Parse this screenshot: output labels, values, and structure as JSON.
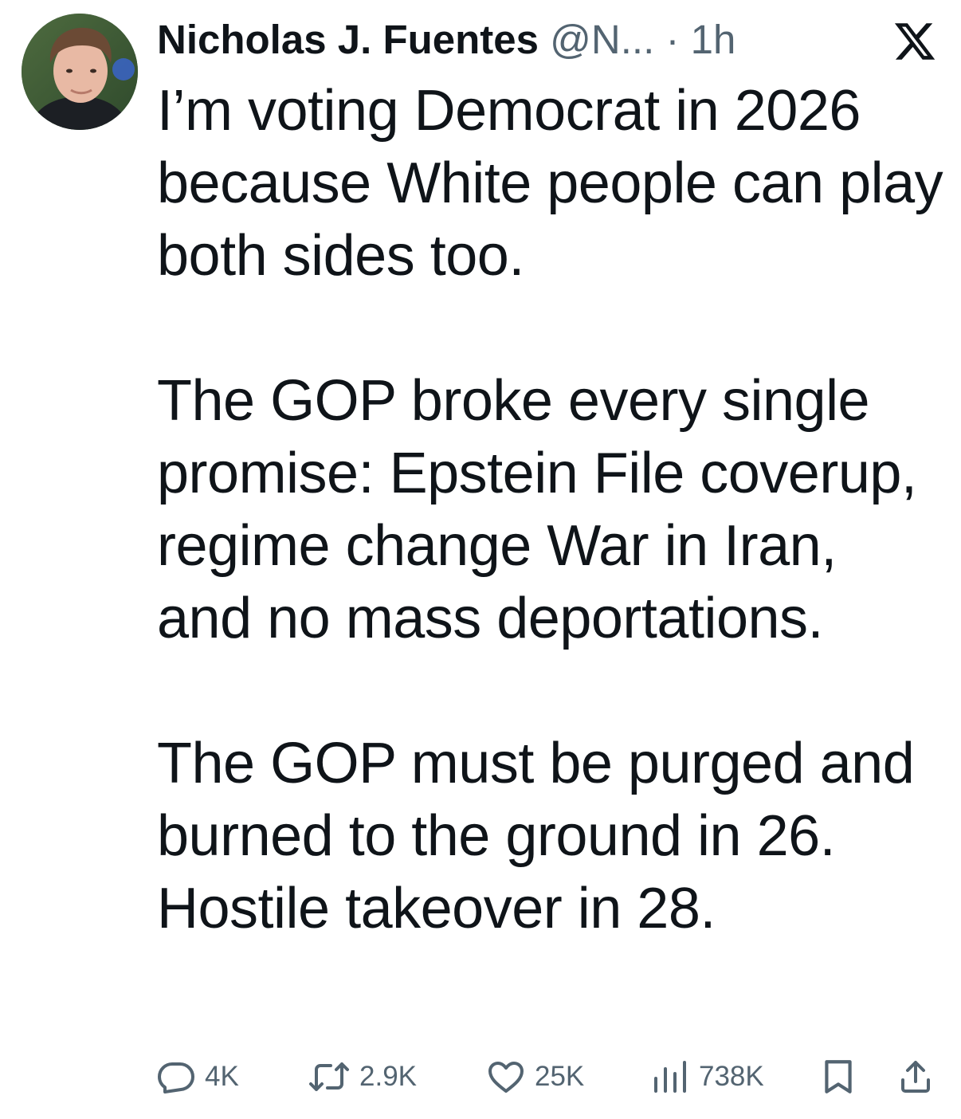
{
  "tweet": {
    "author_name": "Nicholas J. Fuentes",
    "handle": "@N...",
    "separator": "·",
    "time": "1h",
    "paragraphs": [
      "I’m voting Democrat in 2026 because White people can play both sides too.",
      "The GOP broke every single promise: Epstein File coverup, regime change War in Iran, and no mass deportations.",
      "The GOP must be purged and burned to the ground in 26. Hostile takeover in 28."
    ]
  },
  "actions": {
    "replies": "4K",
    "reposts": "2.9K",
    "likes": "25K",
    "views": "738K"
  },
  "icons": {
    "platform": "x-logo-icon",
    "reply": "reply-icon",
    "repost": "repost-icon",
    "like": "heart-icon",
    "views": "views-icon",
    "bookmark": "bookmark-icon",
    "share": "share-icon"
  },
  "colors": {
    "text": "#0f1419",
    "secondary": "#536471",
    "background": "#ffffff"
  }
}
